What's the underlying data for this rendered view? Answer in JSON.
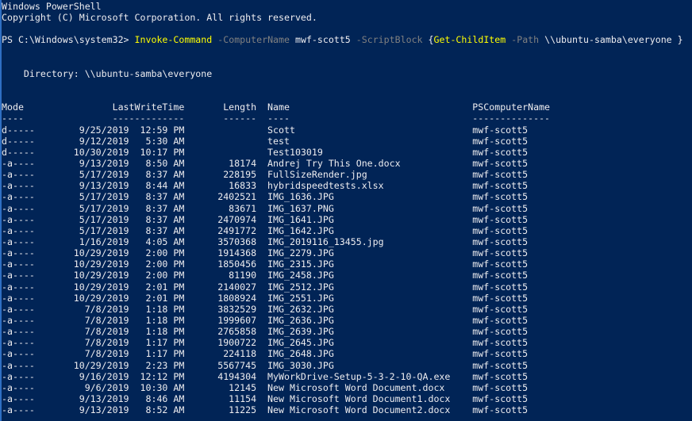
{
  "colors": {
    "background": "#012456",
    "foreground": "#EEEDF0",
    "command": "#FFFF00",
    "parameter": "#808080",
    "window_edge": "#2F6FC3"
  },
  "banner": {
    "line1": "Windows PowerShell",
    "line2": "Copyright (C) Microsoft Corporation. All rights reserved."
  },
  "prompt": "PS C:\\Windows\\system32> ",
  "command": {
    "segments": [
      {
        "text": "Invoke-Command",
        "style": "command"
      },
      {
        "text": " ",
        "style": "default"
      },
      {
        "text": "-ComputerName",
        "style": "parameter"
      },
      {
        "text": " mwf-scott5 ",
        "style": "default"
      },
      {
        "text": "-ScriptBlock",
        "style": "parameter"
      },
      {
        "text": " {",
        "style": "default"
      },
      {
        "text": "Get-ChildItem",
        "style": "command"
      },
      {
        "text": " ",
        "style": "default"
      },
      {
        "text": "-Path",
        "style": "parameter"
      },
      {
        "text": " \\\\ubuntu-samba\\everyone }",
        "style": "default"
      }
    ]
  },
  "directory_line": "    Directory: \\\\ubuntu-samba\\everyone",
  "table": {
    "columns": [
      "Mode",
      "LastWriteTime",
      "Length",
      "Name",
      "PSComputerName"
    ],
    "rows": [
      {
        "mode": "d-----",
        "date": "9/25/2019",
        "time": "12:59 PM",
        "length": "",
        "name": "Scott",
        "computer": "mwf-scott5"
      },
      {
        "mode": "d-----",
        "date": "9/12/2019",
        "time": "5:30 AM",
        "length": "",
        "name": "test",
        "computer": "mwf-scott5"
      },
      {
        "mode": "d-----",
        "date": "10/30/2019",
        "time": "10:17 PM",
        "length": "",
        "name": "Test103019",
        "computer": "mwf-scott5"
      },
      {
        "mode": "-a----",
        "date": "9/13/2019",
        "time": "8:50 AM",
        "length": "18174",
        "name": "Andrej Try This One.docx",
        "computer": "mwf-scott5"
      },
      {
        "mode": "-a----",
        "date": "5/17/2019",
        "time": "8:37 AM",
        "length": "228195",
        "name": "FullSizeRender.jpg",
        "computer": "mwf-scott5"
      },
      {
        "mode": "-a----",
        "date": "9/13/2019",
        "time": "8:44 AM",
        "length": "16833",
        "name": "hybridspeedtests.xlsx",
        "computer": "mwf-scott5"
      },
      {
        "mode": "-a----",
        "date": "5/17/2019",
        "time": "8:37 AM",
        "length": "2402521",
        "name": "IMG_1636.JPG",
        "computer": "mwf-scott5"
      },
      {
        "mode": "-a----",
        "date": "5/17/2019",
        "time": "8:37 AM",
        "length": "83671",
        "name": "IMG_1637.PNG",
        "computer": "mwf-scott5"
      },
      {
        "mode": "-a----",
        "date": "5/17/2019",
        "time": "8:37 AM",
        "length": "2470974",
        "name": "IMG_1641.JPG",
        "computer": "mwf-scott5"
      },
      {
        "mode": "-a----",
        "date": "5/17/2019",
        "time": "8:37 AM",
        "length": "2491772",
        "name": "IMG_1642.JPG",
        "computer": "mwf-scott5"
      },
      {
        "mode": "-a----",
        "date": "1/16/2019",
        "time": "4:05 AM",
        "length": "3570368",
        "name": "IMG_2019116_13455.jpg",
        "computer": "mwf-scott5"
      },
      {
        "mode": "-a----",
        "date": "10/29/2019",
        "time": "2:00 PM",
        "length": "1914368",
        "name": "IMG_2279.JPG",
        "computer": "mwf-scott5"
      },
      {
        "mode": "-a----",
        "date": "10/29/2019",
        "time": "2:00 PM",
        "length": "1850456",
        "name": "IMG_2315.JPG",
        "computer": "mwf-scott5"
      },
      {
        "mode": "-a----",
        "date": "10/29/2019",
        "time": "2:00 PM",
        "length": "81190",
        "name": "IMG_2458.JPG",
        "computer": "mwf-scott5"
      },
      {
        "mode": "-a----",
        "date": "10/29/2019",
        "time": "2:01 PM",
        "length": "2140027",
        "name": "IMG_2512.JPG",
        "computer": "mwf-scott5"
      },
      {
        "mode": "-a----",
        "date": "10/29/2019",
        "time": "2:01 PM",
        "length": "1808924",
        "name": "IMG_2551.JPG",
        "computer": "mwf-scott5"
      },
      {
        "mode": "-a----",
        "date": "7/8/2019",
        "time": "1:18 PM",
        "length": "3832529",
        "name": "IMG_2632.JPG",
        "computer": "mwf-scott5"
      },
      {
        "mode": "-a----",
        "date": "7/8/2019",
        "time": "1:18 PM",
        "length": "1999607",
        "name": "IMG_2636.JPG",
        "computer": "mwf-scott5"
      },
      {
        "mode": "-a----",
        "date": "7/8/2019",
        "time": "1:18 PM",
        "length": "2765858",
        "name": "IMG_2639.JPG",
        "computer": "mwf-scott5"
      },
      {
        "mode": "-a----",
        "date": "7/8/2019",
        "time": "1:17 PM",
        "length": "1900722",
        "name": "IMG_2645.JPG",
        "computer": "mwf-scott5"
      },
      {
        "mode": "-a----",
        "date": "7/8/2019",
        "time": "1:17 PM",
        "length": "224118",
        "name": "IMG_2648.JPG",
        "computer": "mwf-scott5"
      },
      {
        "mode": "-a----",
        "date": "10/29/2019",
        "time": "2:23 PM",
        "length": "5567745",
        "name": "IMG_3030.JPG",
        "computer": "mwf-scott5"
      },
      {
        "mode": "-a----",
        "date": "9/16/2019",
        "time": "12:12 PM",
        "length": "4194304",
        "name": "MyWorkDrive-Setup-5-3-2-10-QA.exe",
        "computer": "mwf-scott5"
      },
      {
        "mode": "-a----",
        "date": "9/6/2019",
        "time": "10:30 AM",
        "length": "12145",
        "name": "New Microsoft Word Document.docx",
        "computer": "mwf-scott5"
      },
      {
        "mode": "-a----",
        "date": "9/13/2019",
        "time": "8:46 AM",
        "length": "11154",
        "name": "New Microsoft Word Document1.docx",
        "computer": "mwf-scott5"
      },
      {
        "mode": "-a----",
        "date": "9/13/2019",
        "time": "8:52 AM",
        "length": "11225",
        "name": "New Microsoft Word Document2.docx",
        "computer": "mwf-scott5"
      }
    ]
  }
}
